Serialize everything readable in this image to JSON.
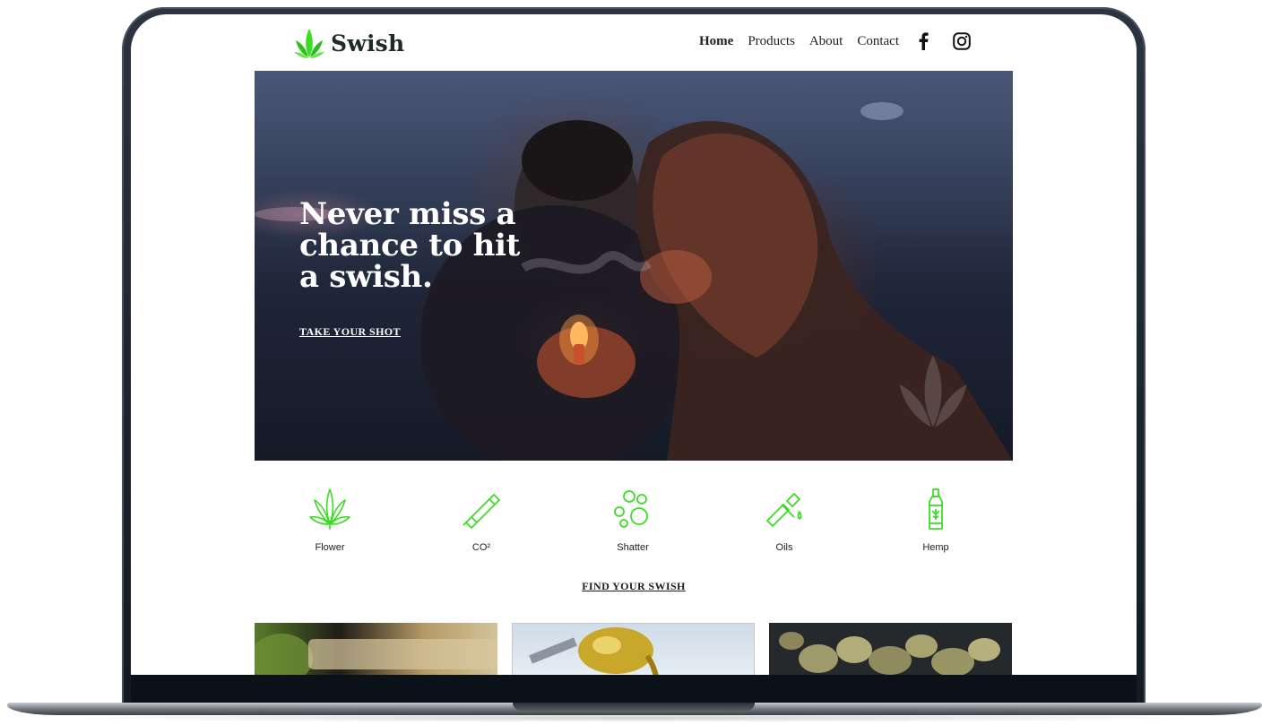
{
  "brand": {
    "name": "Swish",
    "accent": "#3ddc24",
    "dark_text": "#1f2b2a"
  },
  "nav": {
    "items": [
      {
        "label": "Home",
        "active": true
      },
      {
        "label": "Products",
        "active": false
      },
      {
        "label": "About",
        "active": false
      },
      {
        "label": "Contact",
        "active": false
      }
    ],
    "social_icons": [
      "facebook-icon",
      "instagram-icon"
    ]
  },
  "hero": {
    "heading": "Never miss a chance to hit a swish.",
    "cta_label": "TAKE YOUR SHOT",
    "watermark_icon": "cannabis-leaf-icon"
  },
  "categories": [
    {
      "label": "Flower",
      "icon": "cannabis-leaf-icon"
    },
    {
      "label": "CO²",
      "icon": "vape-pen-icon"
    },
    {
      "label": "Shatter",
      "icon": "bubbles-icon"
    },
    {
      "label": "Oils",
      "icon": "dropper-icon"
    },
    {
      "label": "Hemp",
      "icon": "bottle-icon"
    }
  ],
  "find_label": "FIND YOUR SWISH"
}
